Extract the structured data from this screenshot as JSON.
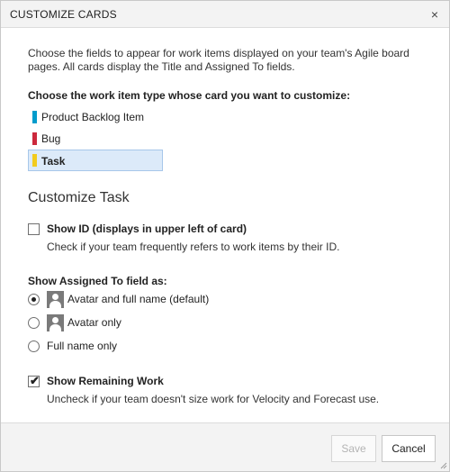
{
  "dialog": {
    "title": "CUSTOMIZE CARDS",
    "close_glyph": "×"
  },
  "intro": {
    "text": "Choose the fields to appear for work items displayed on your team's Agile board pages. All cards display the Title and Assigned To fields."
  },
  "work_item_types": {
    "label": "Choose the work item type whose card you want to customize:",
    "items": [
      {
        "label": "Product Backlog Item",
        "color": "#009ccc",
        "selected": false
      },
      {
        "label": "Bug",
        "color": "#cc293d",
        "selected": false
      },
      {
        "label": "Task",
        "color": "#f2cb1d",
        "selected": true
      }
    ]
  },
  "customize": {
    "heading": "Customize Task",
    "show_id": {
      "label": "Show ID (displays in upper left of card)",
      "description": "Check if your team frequently refers to work items by their ID.",
      "checked": false
    },
    "assigned_to": {
      "label": "Show Assigned To field as:",
      "options": [
        {
          "label": "Avatar and full name (default)",
          "selected": true,
          "icon": "avatar-icon"
        },
        {
          "label": "Avatar only",
          "selected": false,
          "icon": "avatar-icon"
        },
        {
          "label": "Full name only",
          "selected": false,
          "icon": ""
        }
      ]
    },
    "show_remaining_work": {
      "label": "Show Remaining Work",
      "description": "Uncheck if your team doesn't size work for Velocity and Forecast use.",
      "checked": true
    }
  },
  "footer": {
    "save_label": "Save",
    "save_enabled": false,
    "cancel_label": "Cancel"
  },
  "colors": {
    "selected_bg": "#dceaf9",
    "selected_border": "#a7c7ea"
  }
}
